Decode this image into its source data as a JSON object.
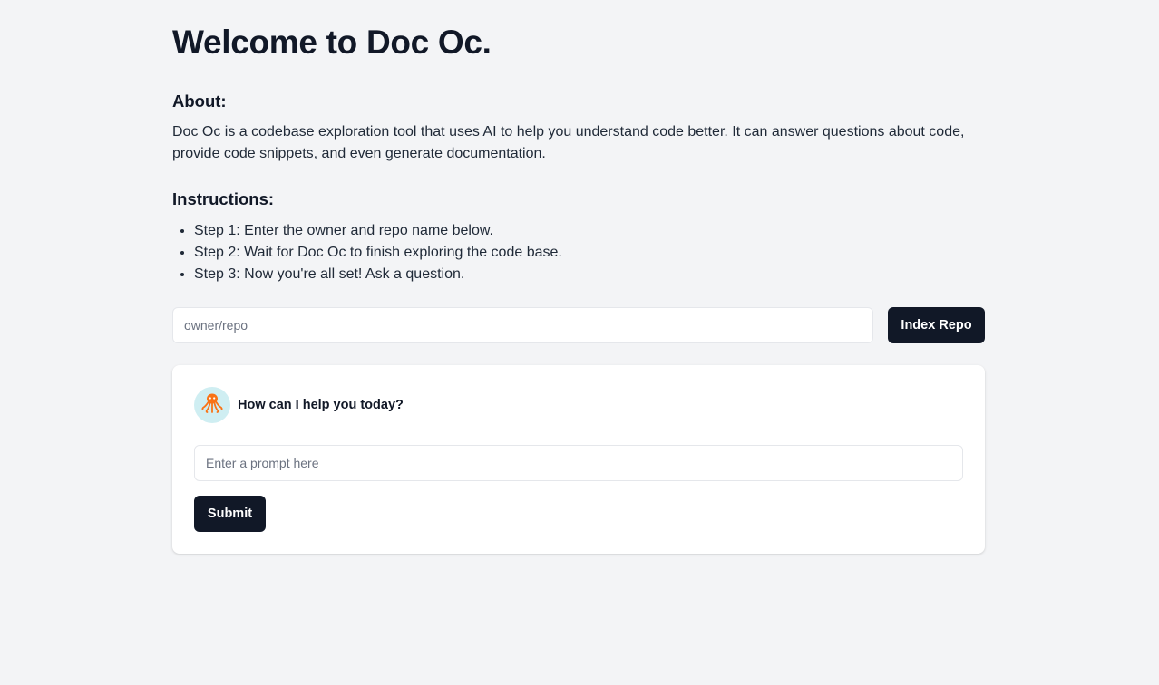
{
  "header": {
    "title": "Welcome to Doc Oc."
  },
  "about": {
    "heading": "About:",
    "text": "Doc Oc is a codebase exploration tool that uses AI to help you understand code better. It can answer questions about code, provide code snippets, and even generate documentation."
  },
  "instructions": {
    "heading": "Instructions:",
    "steps": [
      "Step 1: Enter the owner and repo name below.",
      "Step 2: Wait for Doc Oc to finish exploring the code base.",
      "Step 3: Now you're all set! Ask a question."
    ]
  },
  "repo_form": {
    "placeholder": "owner/repo",
    "value": "",
    "button_label": "Index Repo"
  },
  "chat": {
    "avatar_icon": "octopus-icon",
    "greeting": "How can I help you today?",
    "prompt_placeholder": "Enter a prompt here",
    "prompt_value": "",
    "submit_label": "Submit"
  },
  "colors": {
    "background": "#f3f4f6",
    "button": "#111827",
    "avatar_bg": "#cfeef2",
    "octopus": "#f97316"
  }
}
